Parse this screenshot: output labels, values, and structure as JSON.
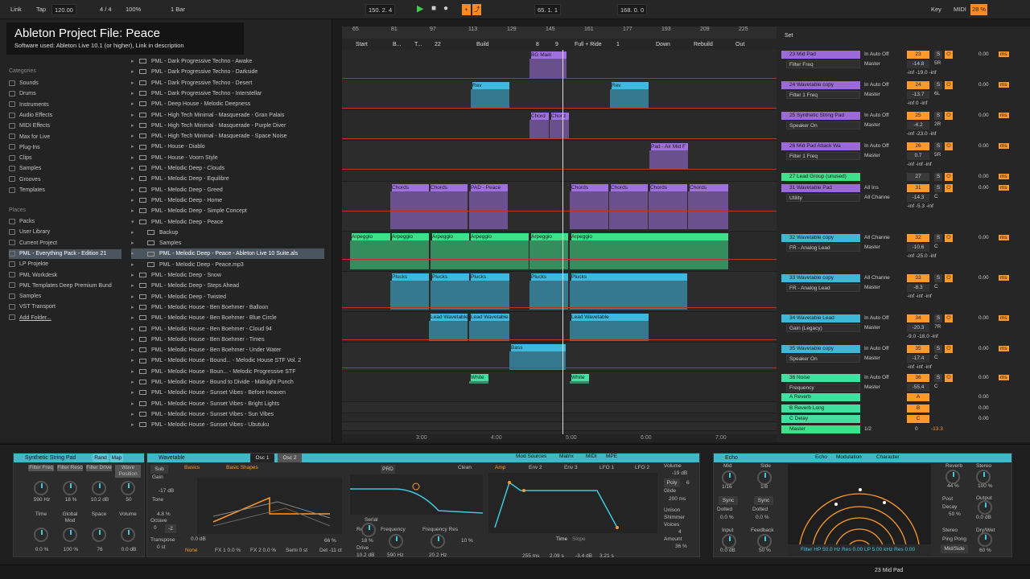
{
  "overlay": {
    "title": "Ableton Project File: Peace",
    "subtitle": "Software used: Ableton Live 10.1 (or higher), Link in description"
  },
  "topbar": {
    "link": "Link",
    "tap": "Tap",
    "tempo": "120.00",
    "meter": "4 / 4",
    "zoom": "100%",
    "quant": "1 Bar",
    "position": "150.  2.  4",
    "loop_start": "65.  1.  1",
    "loop_length": "168.  0.  0",
    "key": "Key",
    "midi": "MIDI",
    "cpu": "28 %"
  },
  "browser": {
    "categories_header": "Categories",
    "categories": [
      "Sounds",
      "Drums",
      "Instruments",
      "Audio Effects",
      "MIDI Effects",
      "Max for Live",
      "Plug-Ins",
      "Clips",
      "Samples",
      "Grooves",
      "Templates"
    ],
    "places_header": "Places",
    "places": [
      "Packs",
      "User Library",
      "Current Project",
      "PML - Everything Pack - Edition 21",
      "LP Projekte",
      "PML Workdesk",
      "PML Templates Deep Premium Bund",
      "Samples",
      "VST Transport",
      "Add Folder..."
    ],
    "items": [
      "PML - Dark Progressive Techno - Awake",
      "PML - Dark Progressive Techno - Darkside",
      "PML - Dark Progressive Techno - Desert",
      "PML - Dark Progressive Techno - Interstellar",
      "PML - Deep House - Melodic Deepness",
      "PML - High Tech Minimal - Masquerade - Gran Palais",
      "PML - High Tech Minimal - Masquerade - Purple Diver",
      "PML - High Tech Minimal - Masquerade - Space Noise",
      "PML - House - Diablo",
      "PML - House - Voorn Style",
      "PML - Melodic Deep - Clouds",
      "PML - Melodic Deep - Equilibre",
      "PML - Melodic Deep - Greed",
      "PML - Melodic Deep - Home",
      "PML - Melodic Deep - Simple Concept",
      "PML - Melodic Deep - Peace",
      "Backup",
      "Samples",
      "PML - Melodic Deep - Peace - Ableton Live 10 Suite.als",
      "PML - Melodic Deep - Peace.mp3",
      "PML - Melodic Deep - Snow",
      "PML - Melodic Deep - Steps Ahead",
      "PML - Melodic Deep - Twisted",
      "PML - Melodic House - Ben Boehmer - Balloon",
      "PML - Melodic House - Ben Boehmer - Blue Circle",
      "PML - Melodic House - Ben Boehmer - Cloud 94",
      "PML - Melodic House - Ben Boehmer - Times",
      "PML - Melodic House - Ben Boehmer - Under Water",
      "PML - Melodic House - Bound... - Melodic House STF Vol. 2",
      "PML - Melodic House - Boun... - Melodic Progressive STF",
      "PML - Melodic House - Bound to Divide - Midnight Punch",
      "PML - Melodic House - Sunset Vibes - Before Heaven",
      "PML - Melodic House - Sunset Vibes - Bright Lights",
      "PML - Melodic House - Sunset Vibes - Sun Vibes",
      "PML - Melodic House - Sunset Vibes - Ubutuku"
    ]
  },
  "ruler": {
    "bars": [
      "65",
      "81",
      "97",
      "113",
      "129",
      "145",
      "161",
      "177",
      "193",
      "209",
      "225"
    ],
    "markers": [
      "Start",
      "B...",
      "T...",
      "22",
      "Build",
      "8",
      "9",
      "Full + Ride",
      "1",
      "Down",
      "Rebuild",
      "Out"
    ],
    "times": [
      "3:00",
      "4:00",
      "5:00",
      "6:00",
      "7:00"
    ]
  },
  "clips": {
    "bg_main": "BG Main",
    "rev": "Rev",
    "chord": "Chord",
    "pad_air": "Pad - Air Mid F",
    "chords": "Chords",
    "pad_peace": "PAD - Peace",
    "arpeggio": "Arpeggio",
    "plucks": "Plucks",
    "lead_wavetable": "Lead Wavetable",
    "bass": "Bass",
    "white": "White"
  },
  "mixer": {
    "set": "Set",
    "tracks": [
      {
        "name": "23 Mid Pad",
        "dev": "Filter Freq",
        "io": "In  Auto  Off",
        "route": "Master",
        "num": "23",
        "vol": "-14.8",
        "pan": "5R",
        "send": "-inf  -19.0  -inf",
        "color": "#9b6ad8"
      },
      {
        "name": "24 Wavetable copy",
        "dev": "Filter 1 Freq",
        "io": "In  Auto  Off",
        "route": "Master",
        "num": "24",
        "vol": "-13.7",
        "pan": "6L",
        "send": "-inf  0  -inf",
        "color": "#9b6ad8"
      },
      {
        "name": "25 Synthetic String Pad",
        "dev": "Speaker On",
        "io": "In  Auto  Off",
        "route": "Master",
        "num": "25",
        "vol": "-4.2",
        "pan": "2R",
        "send": "-inf  -23.0  -inf",
        "color": "#9b6ad8"
      },
      {
        "name": "26 Mid Pad Attack Wa",
        "dev": "Filter 1 Freq",
        "io": "In  Auto  Off",
        "route": "Master",
        "num": "26",
        "vol": "0.7",
        "pan": "5R",
        "send": "-inf  -inf  -inf",
        "color": "#9b6ad8"
      },
      {
        "name": "27 Lead Group (unused)",
        "dev": "",
        "io": "",
        "route": "",
        "num": "27",
        "vol": "",
        "pan": "",
        "send": "",
        "color": "#3fe08a"
      },
      {
        "name": "31 Wavetable Pad",
        "dev": "Utility",
        "io": "All Ins",
        "route": "All Channe",
        "num": "31",
        "vol": "-14.3",
        "pan": "C",
        "send": "-inf  -5.3  -inf",
        "color": "#9b6ad8"
      },
      {
        "name": "32 Wavetable copy",
        "dev": "FR - Analog Lead",
        "io": "All Channe",
        "route": "Master",
        "num": "32",
        "vol": "-10.6",
        "pan": "C",
        "send": "-inf  -25.0  -inf",
        "color": "#3fb8d8"
      },
      {
        "name": "33 Wavetable copy",
        "dev": "FR - Analog Lead",
        "io": "All Channe",
        "route": "Master",
        "num": "33",
        "vol": "-8.3",
        "pan": "C",
        "send": "-inf  -inf  -inf",
        "color": "#3fb8d8"
      },
      {
        "name": "34 Wavetable Lead",
        "dev": "Gain (Legacy)",
        "io": "In  Auto  Off",
        "route": "Master",
        "num": "34",
        "vol": "-20.3",
        "pan": "7R",
        "send": "-9.0  -18.0  -inf",
        "color": "#3fb8d8"
      },
      {
        "name": "35 Wavetable copy",
        "dev": "Speaker On",
        "io": "In  Auto  Off",
        "route": "Master",
        "num": "35",
        "vol": "-17.4",
        "pan": "C",
        "send": "-inf  -inf  -inf",
        "color": "#3fb8d8"
      },
      {
        "name": "36 Noise",
        "dev": "Frequency",
        "io": "In  Auto  Off",
        "route": "Master",
        "num": "36",
        "vol": "-55.4",
        "pan": "C",
        "send": "",
        "color": "#3fe0a0"
      }
    ],
    "returns": [
      {
        "name": "A Reverb",
        "num": "A"
      },
      {
        "name": "B Reverb Long",
        "num": "B"
      },
      {
        "name": "C Delay",
        "num": "C"
      }
    ],
    "master": {
      "name": "Master",
      "route": "1/2",
      "num": "0",
      "vol": "-13.3"
    }
  },
  "devices": {
    "rack": {
      "title": "Synthetic String Pad",
      "rand": "Rand",
      "map": "Map",
      "macros": [
        {
          "label": "Filter Freq",
          "value": "590 Hz"
        },
        {
          "label": "Filter Reso",
          "value": "18 %"
        },
        {
          "label": "Filter Drive",
          "value": "10.2 dB"
        },
        {
          "label": "Wave Position",
          "value": "50"
        },
        {
          "label": "Time",
          "value": "0.0 %"
        },
        {
          "label": "Global Mod",
          "value": "100 %"
        },
        {
          "label": "Space",
          "value": "76"
        },
        {
          "label": "Volume",
          "value": "0.0 dB"
        }
      ]
    },
    "wavetable": {
      "title": "Wavetable",
      "osc1": "Osc 1",
      "osc2": "Osc 2",
      "sub": "Sub",
      "basics": "Basics",
      "shapes": "Basic Shapes",
      "gain": "Gain",
      "gain_v": "-17 dB",
      "tone": "Tone",
      "tone_v": "4.8 %",
      "octave": "Octave",
      "oct_v": "0",
      "oct2": "-2",
      "transpose": "Transpose",
      "trans_v": "0 st",
      "none": "None",
      "fx1": "FX 1  0.0 %",
      "fx2": "FX 2  0.0 %",
      "semi": "Semi  0 st",
      "det": "Det  -11 ct",
      "zero_db": "0.0 dB",
      "pct": "66 %",
      "filter_mode": "PRD",
      "serial": "Serial",
      "clean": "Clean",
      "res": "Res",
      "res_v": "18 %",
      "freq": "Frequency",
      "freq_v": "590 Hz",
      "freqres": "Frequency Res",
      "fr_v": "20.2 Hz",
      "drive": "Drive",
      "drive_v": "10.2 dB",
      "pct2": "10 %",
      "modsrc": "Mod Sources",
      "matrix": "Matrix",
      "midi": "MIDI",
      "mpe": "MPE",
      "amp": "Amp",
      "env2": "Env 2",
      "env3": "Env 3",
      "lfo1": "LFO 1",
      "lfo2": "LFO 2",
      "time": "Time",
      "slope": "Slope",
      "a": "255 ms",
      "d": "2.09 s",
      "s": "-3.4 dB",
      "r": "3.21 s",
      "vol": "Volume",
      "vol_v": "-19 dB",
      "poly": "Poly",
      "poly_n": "6",
      "glide": "Glide",
      "glide_v": "200 ms",
      "unison": "Unison",
      "shimmer": "Shimmer",
      "voices": "Voices",
      "voices_n": "4",
      "amount": "Amount",
      "amount_v": "36 %"
    },
    "echo": {
      "title": "Echo",
      "tab_echo": "Echo",
      "tab_mod": "Modulation",
      "tab_char": "Character",
      "mid": "Mid",
      "side": "Side",
      "mid_v": "1/16",
      "side_v": "1/8",
      "sync": "Sync",
      "dotted": "Dotted",
      "pct": "0.0 %",
      "input": "Input",
      "input_v": "0.0 dB",
      "feedback": "Feedback",
      "fb_v": "50 %",
      "reverb": "Reverb",
      "rev_v": "44 %",
      "stereo": "Stereo",
      "st_v": "100 %",
      "post": "Post",
      "decay": "Decay",
      "decay_v": "50 %",
      "output": "Output",
      "out_v": "0.0 dB",
      "stereo2": "Stereo",
      "pingpong": "Ping Pong",
      "midside": "Mid/Side",
      "drywet": "Dry/Wet",
      "dw_v": "60 %",
      "filter": "Filter HP  50.0 Hz   Res 0.00   LP  5.00 kHz  Res 0.00"
    }
  },
  "status": {
    "track": "23 Mid Pad"
  }
}
